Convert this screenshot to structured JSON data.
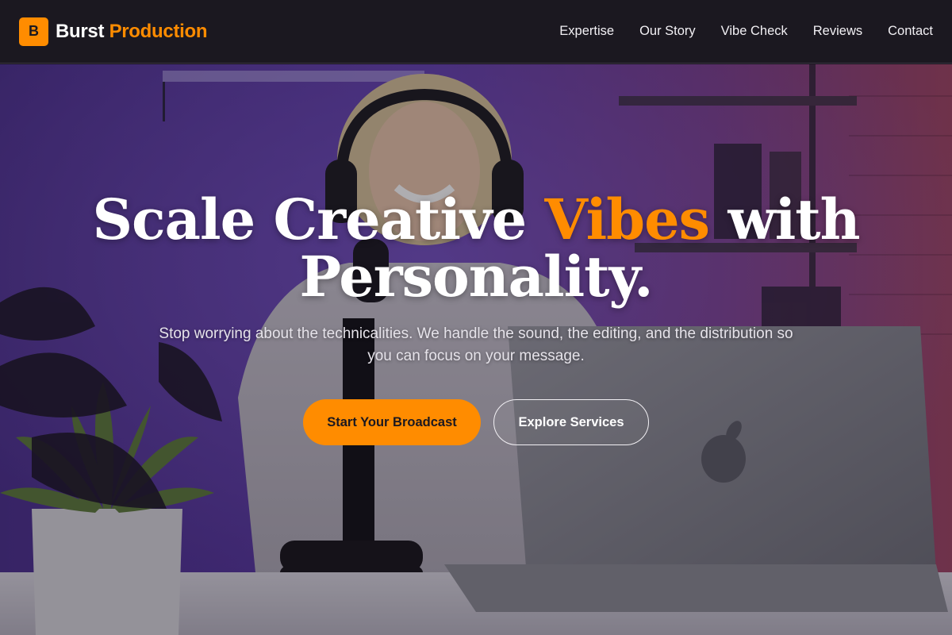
{
  "brand": {
    "mark": "B",
    "word_primary": "Burst",
    "word_accent": "Production"
  },
  "nav": {
    "items": [
      "Expertise",
      "Our Story",
      "Vibe Check",
      "Reviews",
      "Contact"
    ]
  },
  "hero": {
    "headline_part1": "Scale Creative",
    "headline_accent": "Vibes",
    "headline_part2": "with",
    "headline_line2": "Personality.",
    "subtitle": "Stop worrying about the technicalities. We handle the sound, the editing, and the distribution so you can focus on your message.",
    "primary_cta": "Start Your Broadcast",
    "secondary_cta": "Explore Services"
  },
  "colors": {
    "accent": "#ff8c00",
    "header_bg": "#1b1820",
    "text_light": "#ffffff"
  }
}
